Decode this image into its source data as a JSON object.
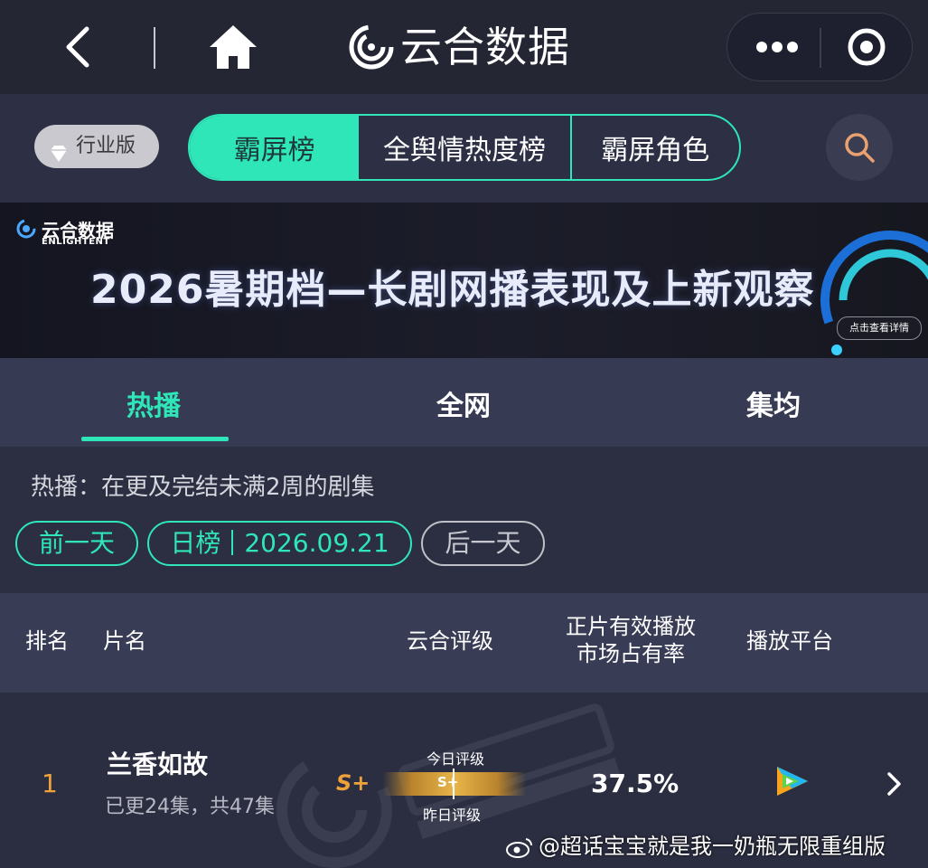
{
  "top_bar": {
    "app_title": "云合数据",
    "icons": [
      "back-icon",
      "home-icon",
      "logo-icon",
      "more-icon",
      "close-circle-icon"
    ]
  },
  "header": {
    "badge": "行业版",
    "tabs": [
      {
        "label": "霸屏榜",
        "active": true
      },
      {
        "label": "全舆情热度榜",
        "active": false
      },
      {
        "label": "霸屏角色",
        "active": false
      }
    ],
    "search_icon": "search-icon"
  },
  "banner": {
    "brand": "云合数据",
    "brand_en": "ENLIGHTENT",
    "title": "2026暑期档—长剧网播表现及上新观察",
    "button": "点击查看详情"
  },
  "sub_tabs": [
    {
      "label": "热播",
      "active": true
    },
    {
      "label": "全网",
      "active": false
    },
    {
      "label": "集均",
      "active": false
    }
  ],
  "info": {
    "description": "热播：在更及完结未满2周的剧集",
    "prev_day": "前一天",
    "date_type": "日榜",
    "date": "2026.09.21",
    "next_day": "后一天"
  },
  "table": {
    "headers": {
      "rank": "排名",
      "title": "片名",
      "grade": "云合评级",
      "share_line1": "正片有效播放",
      "share_line2": "市场占有率",
      "platform": "播放平台"
    },
    "rows": [
      {
        "rank": "1",
        "title": "兰香如故",
        "episodes": "已更24集，共47集",
        "grade": "S+",
        "bar_grade": "S+",
        "today_label": "今日评级",
        "yesterday_label": "昨日评级",
        "share": "37.5%",
        "platform_icon": "tencent-video-icon"
      }
    ]
  },
  "watermark": {
    "text": "@超话宝宝就是我一奶瓶无限重组版"
  },
  "colors": {
    "accent": "#2ee6b8",
    "rank_orange": "#f0a23a",
    "background": "#2a2d3f"
  }
}
